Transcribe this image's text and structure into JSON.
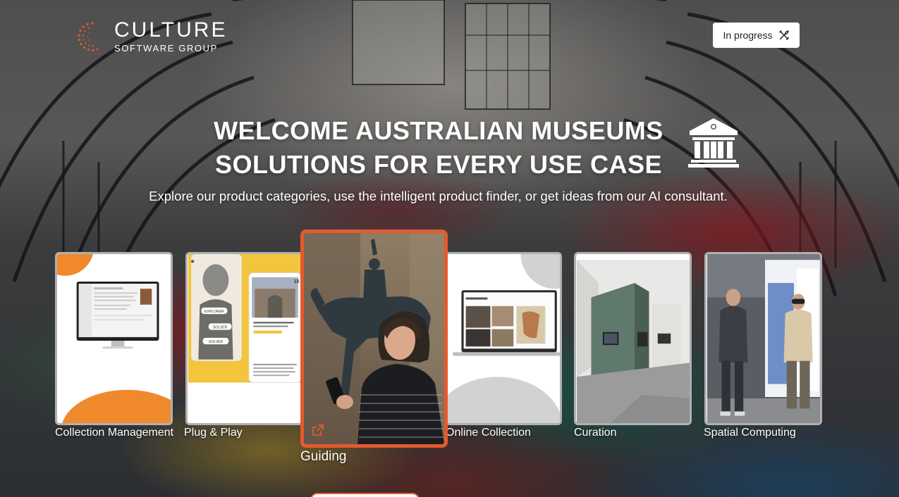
{
  "brand": {
    "title": "CULTURE",
    "subtitle": "SOFTWARE GROUP",
    "accent": "#e45a2e"
  },
  "header": {
    "status_label": "In progress",
    "status_icon": "tools-icon"
  },
  "hero": {
    "title_line1": "WELCOME AUSTRALIAN MUSEUMS",
    "title_line2": "SOLUTIONS FOR EVERY USE CASE",
    "subtitle": "Explore our product categories, use the intelligent product finder, or get ideas from our AI consultant.",
    "icon": "museum-icon"
  },
  "categories": [
    {
      "label": "Collection Management"
    },
    {
      "label": "Plug & Play"
    },
    {
      "label": "Guiding",
      "active": true
    },
    {
      "label": "Online Collection"
    },
    {
      "label": "Curation"
    },
    {
      "label": "Spatial Computing"
    }
  ],
  "plugplay": {
    "buttons": [
      "EXPLORER",
      "SOLVER",
      "SOLVER"
    ],
    "date": "15"
  }
}
